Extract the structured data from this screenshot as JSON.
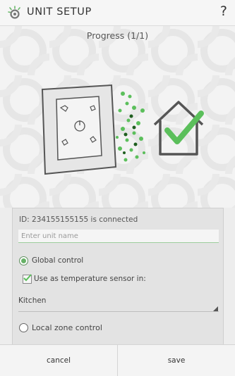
{
  "header": {
    "title": "UNIT SETUP",
    "help_label": "?",
    "app_icon": "gear-icon"
  },
  "progress": {
    "label": "Progress (1/1)"
  },
  "illustration": {
    "device_icons": [
      "hand-icon",
      "hand-icon",
      "hand-icon",
      "hand-icon",
      "power-icon"
    ],
    "house_icon": "house-check-icon",
    "accent_color": "#5bbf5b"
  },
  "panel": {
    "connection_status": "ID: 234155155155 is connected",
    "unit_name": {
      "value": "",
      "placeholder": "Enter unit name"
    },
    "global_control": {
      "label": "Global control",
      "selected": true
    },
    "temperature_sensor": {
      "label": "Use as temperature sensor in:",
      "checked": true
    },
    "room_select": {
      "value": "Kitchen"
    },
    "local_zone_control": {
      "label": "Local zone control",
      "selected": false
    }
  },
  "footer": {
    "cancel_label": "cancel",
    "save_label": "save"
  }
}
